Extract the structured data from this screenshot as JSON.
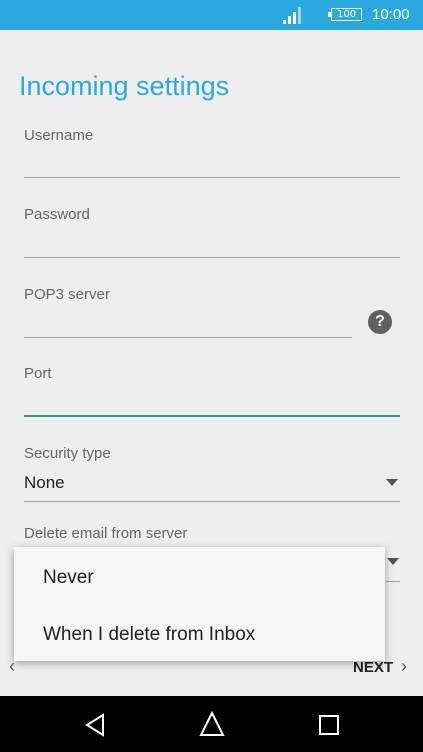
{
  "status_bar": {
    "time": "10:00",
    "battery": "100"
  },
  "page": {
    "title": "Incoming settings"
  },
  "fields": {
    "username_label": "Username",
    "password_label": "Password",
    "pop3_label": "POP3 server",
    "port_label": "Port",
    "security_label": "Security type",
    "security_value": "None",
    "delete_label": "Delete email from server"
  },
  "help_icon": "?",
  "menu": {
    "items": [
      "Never",
      "When I delete from Inbox"
    ]
  },
  "nav": {
    "back_icon": "‹",
    "next_label": "NEXT",
    "next_icon": "›"
  },
  "icons": {
    "signal": "signal-icon",
    "battery": "battery-icon",
    "help": "help-icon",
    "dropdown": "dropdown-arrow-icon",
    "back": "back-icon",
    "home": "home-icon",
    "recents": "recents-icon"
  },
  "colors": {
    "status_bar": "#29a9e0",
    "title": "#2aa9e3",
    "focus_line": "#2a9a8d",
    "background": "#eeeeee"
  }
}
